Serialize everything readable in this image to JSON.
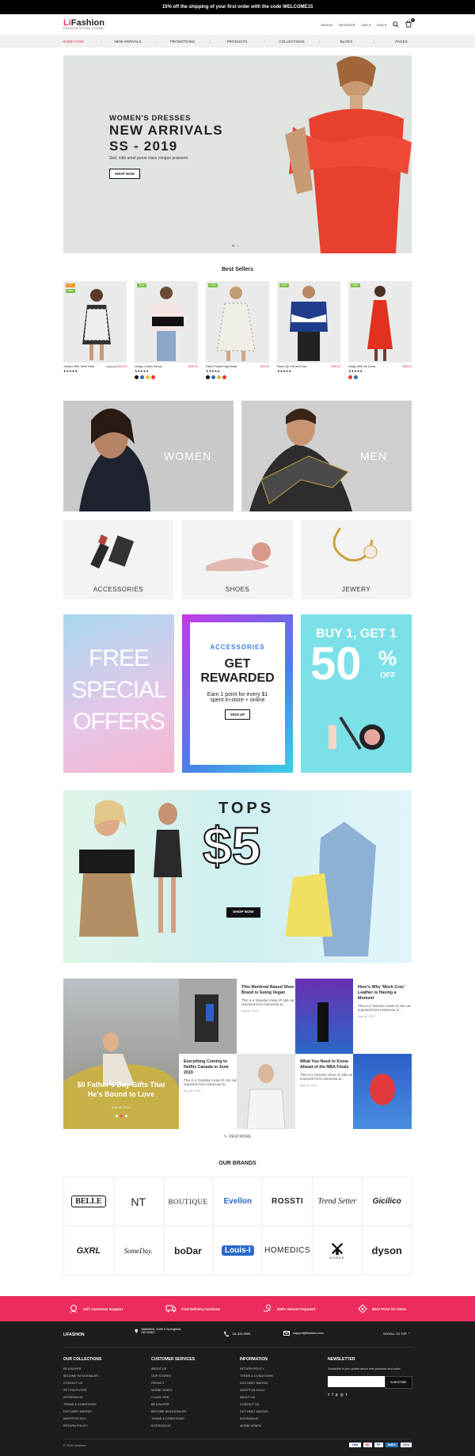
{
  "topbar": {
    "text": "15% off the shipping of your first order with the code WELCOME15"
  },
  "header": {
    "logo_a": "Li",
    "logo_b": "Fashion",
    "tagline": "FASHION STORE THEME",
    "signin": "SIGN IN",
    "register": "REGISTER",
    "currency": "USD",
    "language": "ENG",
    "cart_count": "0"
  },
  "nav": {
    "items": [
      "HOME PAGE",
      "NEW ARRIVALS",
      "PROMOTIONS",
      "PRODUCTS",
      "COLLECTIONS",
      "BLOGS",
      "PAGES"
    ]
  },
  "hero": {
    "subtitle": "WOMEN'S DRESSES",
    "title1": "NEW ARRIVALS",
    "title2": "SS - 2019",
    "desc": "Sed, nibh amet purus class congue praesent.",
    "button": "SHOP NOW"
  },
  "bestsellers": {
    "title": "Best Sellers",
    "products": [
      {
        "name": "Jumper With Turtle Neck",
        "old": "$100.00",
        "price": "$98.00",
        "stars": "★★★★★",
        "badges": [
          "-5%",
          "NEW"
        ]
      },
      {
        "name": "Design Cotton Smock",
        "price": "$98.00",
        "stars": "★★★★★",
        "badges": [
          "NEW"
        ]
      },
      {
        "name": "Patch Pocket High Waist",
        "price": "$98.00",
        "stars": "★★★★★",
        "badges": [
          "NEW"
        ]
      },
      {
        "name": "Panel Zip Get And Now",
        "price": "$98.00",
        "stars": "★★★★★",
        "badges": [
          "NEW"
        ]
      },
      {
        "name": "Indigo With Zip Dress",
        "price": "$98.00",
        "stars": "★★★★★",
        "badges": [
          "NEW"
        ]
      }
    ]
  },
  "categories": {
    "women": "WOMEN",
    "men": "MEN",
    "accessories": "ACCESSORIES",
    "shoes": "SHOES",
    "jewery": "JEWERY"
  },
  "promos": {
    "free1": "FREE",
    "free2": "SPECIAL",
    "free3": "OFFERS",
    "acc": "ACCESSORIES",
    "get": "GET",
    "rewarded": "REWARDED",
    "earn1": "Earn 1 point for every $1",
    "earn2": "spent in-store + online",
    "signup": "SIGN UP",
    "buy": "BUY 1, GET 1",
    "fifty": "50",
    "pct": "%",
    "off": "OFF"
  },
  "tops": {
    "title": "TOPS",
    "price": "$5",
    "button": "SHOP NOW"
  },
  "blog": {
    "main_title": "$0 Father's Day Gifts That He's Bound to Love",
    "main_date": "Aug 06, 2019",
    "posts": [
      {
        "title": "This Montreal Based Shoe Brand is Going Vegan",
        "text": "This is a Yamaha Vision R 155 car imported from Indonesia to...",
        "date": "Aug 06, 2019"
      },
      {
        "title": "Here's Why 'Mock Croc' Leather is Having a Moment",
        "text": "This is a Yamaha Vision R 155 car imported from Indonesia to...",
        "date": "Aug 06, 2019"
      },
      {
        "title": "Everything Coming to Netflix Canada in June 2019",
        "text": "This is a Yamaha Vision R 155 car imported from Indonesia to...",
        "date": "Aug 06, 2019"
      },
      {
        "title": "What You Need to Know Ahead of the NBA Finals",
        "text": "This is a Yamaha Vision R 155 car imported from Indonesia to...",
        "date": "Aug 06, 2019"
      }
    ],
    "view_more": "VIEW MORE"
  },
  "brands": {
    "title": "OUR BRANDS",
    "items": [
      "BELLE",
      "NT",
      "BOUTIQUE",
      "Evellon",
      "ROSSTI",
      "Trend Setter",
      "Gicilico",
      "GXRL",
      "SomeDay.",
      "boDar",
      "Louis-I",
      "HOMEDICS",
      "NORKE",
      "dyson"
    ]
  },
  "features": [
    "24/7 Customer Support",
    "Fast Delivery Services",
    "100% Secure Payment",
    "Best Price for Store"
  ],
  "footer": {
    "logo": "LIFASHION",
    "address": "Battlefield, Suite 0 Springfield, MO 65807",
    "phone": "111-333-9999",
    "email": "support@lifashion.com",
    "scroll": "SCROLL TO TOP",
    "col1_title": "OUR COLLECTIONS",
    "col1": [
      "BE A BUYER",
      "BECOME WHOLESALER",
      "CONTACT US",
      "SET EXLPUTATE",
      "INTERIGIM AT",
      "TERMS & CONDITIONS",
      "DICTUMST MAGNIS",
      "INCEPTOS SOLI",
      "RETURN POLICY"
    ],
    "col2_title": "CUSTOMER SERVICES",
    "col2": [
      "ABOUT US",
      "OUR STORES",
      "PRIVACY",
      "MORBI VENEN",
      "CLASS, PER",
      "BE A BUYER",
      "BECOME WHOLESALER",
      "TERMS & CONDITIONS",
      "INTERIGIM AT"
    ],
    "col3_title": "INFORMATION",
    "col3": [
      "RETURN POLICY",
      "TERMS & CONDITIONS",
      "DICTUMST MAGNIS",
      "INCEPTOS SOLLI",
      "ABOUT US",
      "CONTACT US",
      "DICTUMST MAGNIS",
      "INTERGIM AT",
      "MORBI VENEN"
    ],
    "newsletter_title": "NEWSLETTER",
    "newsletter_text": "Subscribe to get update about new products and sales",
    "subscribe": "SUBSCRIBE",
    "copyright": "© 2019 Lifashion",
    "payments": [
      "VISA",
      "MC",
      "PP",
      "AMEX",
      "VISA"
    ]
  }
}
